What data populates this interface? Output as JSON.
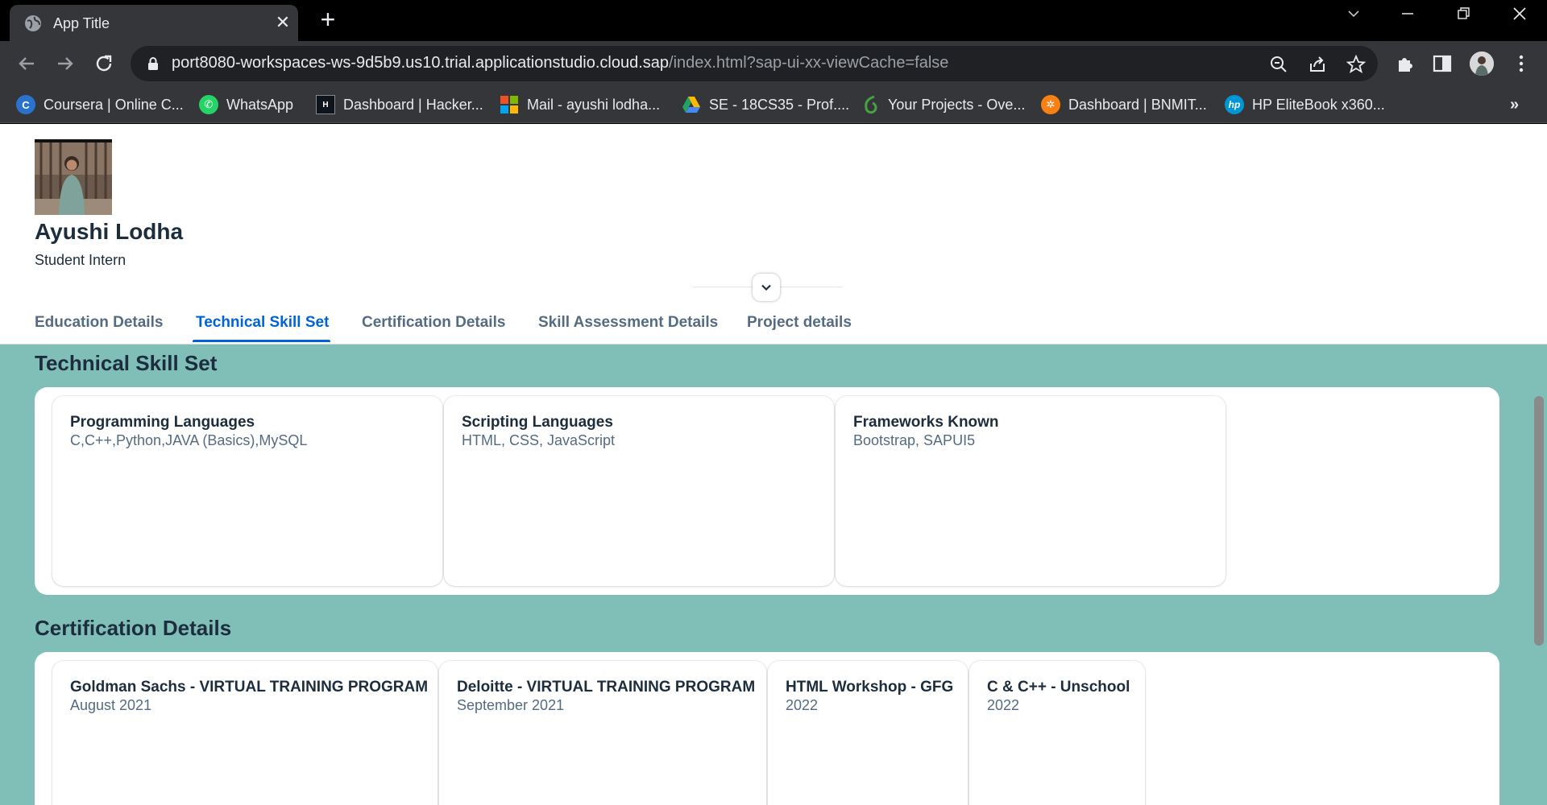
{
  "browser": {
    "tab_title": "App Title",
    "url_host": "port8080-workspaces-ws-9d5b9.us10.trial.applicationstudio.cloud.sap",
    "url_path": "/index.html?sap-ui-xx-viewCache=false",
    "bookmarks": [
      {
        "label": "Coursera | Online C...",
        "icon": "coursera-icon",
        "color": "#2a73cc"
      },
      {
        "label": "WhatsApp",
        "icon": "whatsapp-icon",
        "color": "#25d366"
      },
      {
        "label": "Dashboard | Hacker...",
        "icon": "hackerrank-icon",
        "color": "#000000"
      },
      {
        "label": "Mail - ayushi lodha...",
        "icon": "microsoft-icon",
        "color": "#f25022"
      },
      {
        "label": "SE - 18CS35 - Prof....",
        "icon": "drive-icon",
        "color": "#1fa463"
      },
      {
        "label": "Your Projects - Ove...",
        "icon": "overleaf-icon",
        "color": "#47a141"
      },
      {
        "label": "Dashboard | BNMIT...",
        "icon": "moodle-icon",
        "color": "#f98012"
      },
      {
        "label": "HP EliteBook x360...",
        "icon": "hp-icon",
        "color": "#0096d6"
      }
    ]
  },
  "profile": {
    "name": "Ayushi Lodha",
    "role": "Student Intern"
  },
  "tabs": [
    {
      "label": "Education Details",
      "active": false
    },
    {
      "label": "Technical Skill Set",
      "active": true
    },
    {
      "label": "Certification Details",
      "active": false
    },
    {
      "label": "Skill Assessment Details",
      "active": false
    },
    {
      "label": "Project details",
      "active": false
    }
  ],
  "skills": {
    "title": "Technical Skill Set",
    "cards": [
      {
        "title": "Programming Languages",
        "text": "C,C++,Python,JAVA (Basics),MySQL"
      },
      {
        "title": "Scripting Languages",
        "text": "HTML, CSS, JavaScript"
      },
      {
        "title": "Frameworks Known",
        "text": "Bootstrap, SAPUI5"
      }
    ]
  },
  "certifications": {
    "title": "Certification Details",
    "cards": [
      {
        "title": "Goldman Sachs - VIRTUAL TRAINING PROGRAM",
        "text": "August 2021"
      },
      {
        "title": "Deloitte - VIRTUAL TRAINING PROGRAM",
        "text": "September 2021"
      },
      {
        "title": "HTML Workshop - GFG",
        "text": "2022"
      },
      {
        "title": "C & C++ - Unschool",
        "text": "2022"
      }
    ]
  },
  "colors": {
    "accent": "#0064d9",
    "page_background": "#7fbfb8",
    "title_text": "#1d2d3e",
    "muted_text": "#556b82"
  }
}
